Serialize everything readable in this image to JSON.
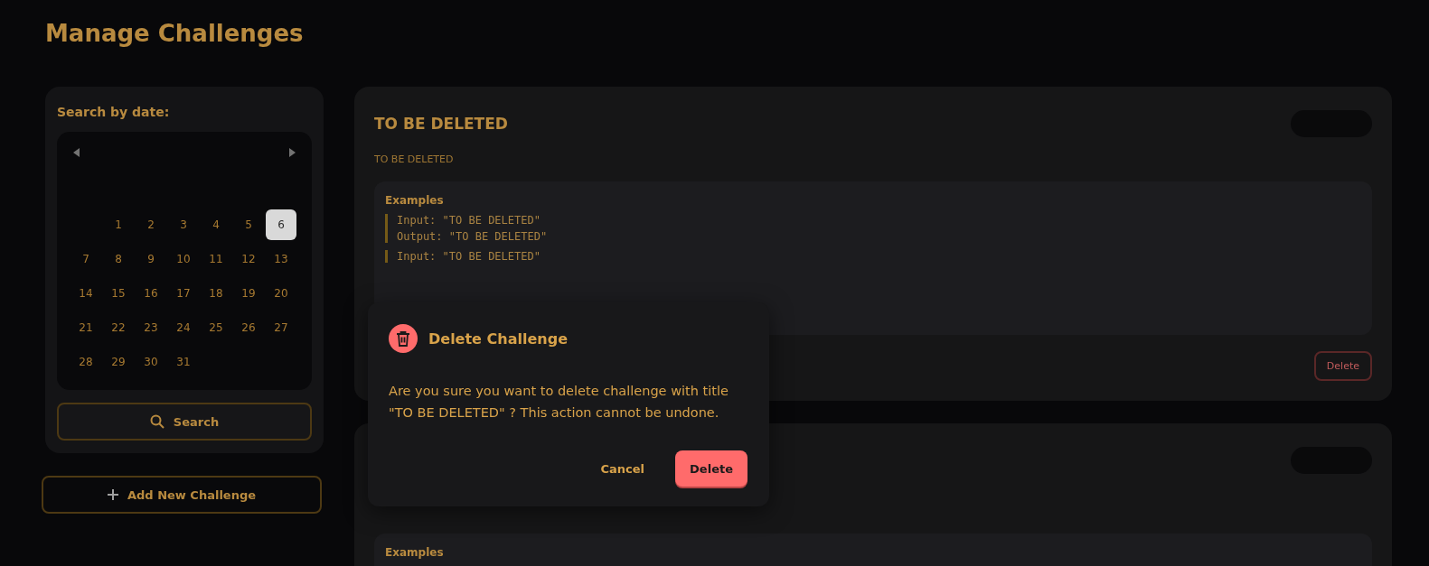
{
  "page": {
    "title": "Manage Challenges"
  },
  "search_panel": {
    "label": "Search by date:",
    "days": [
      {
        "kind": "blank"
      },
      {
        "kind": "day",
        "label": "1",
        "selected": false
      },
      {
        "kind": "day",
        "label": "2",
        "selected": false
      },
      {
        "kind": "day",
        "label": "3",
        "selected": false
      },
      {
        "kind": "day",
        "label": "4",
        "selected": false
      },
      {
        "kind": "day",
        "label": "5",
        "selected": false
      },
      {
        "kind": "day",
        "label": "6",
        "selected": true
      },
      {
        "kind": "day",
        "label": "7",
        "selected": false
      },
      {
        "kind": "day",
        "label": "8",
        "selected": false
      },
      {
        "kind": "day",
        "label": "9",
        "selected": false
      },
      {
        "kind": "day",
        "label": "10",
        "selected": false
      },
      {
        "kind": "day",
        "label": "11",
        "selected": false
      },
      {
        "kind": "day",
        "label": "12",
        "selected": false
      },
      {
        "kind": "day",
        "label": "13",
        "selected": false
      },
      {
        "kind": "day",
        "label": "14",
        "selected": false
      },
      {
        "kind": "day",
        "label": "15",
        "selected": false
      },
      {
        "kind": "day",
        "label": "16",
        "selected": false
      },
      {
        "kind": "day",
        "label": "17",
        "selected": false
      },
      {
        "kind": "day",
        "label": "18",
        "selected": false
      },
      {
        "kind": "day",
        "label": "19",
        "selected": false
      },
      {
        "kind": "day",
        "label": "20",
        "selected": false
      },
      {
        "kind": "day",
        "label": "21",
        "selected": false
      },
      {
        "kind": "day",
        "label": "22",
        "selected": false
      },
      {
        "kind": "day",
        "label": "23",
        "selected": false
      },
      {
        "kind": "day",
        "label": "24",
        "selected": false
      },
      {
        "kind": "day",
        "label": "25",
        "selected": false
      },
      {
        "kind": "day",
        "label": "26",
        "selected": false
      },
      {
        "kind": "day",
        "label": "27",
        "selected": false
      },
      {
        "kind": "day",
        "label": "28",
        "selected": false
      },
      {
        "kind": "day",
        "label": "29",
        "selected": false
      },
      {
        "kind": "day",
        "label": "30",
        "selected": false
      },
      {
        "kind": "day",
        "label": "31",
        "selected": false
      }
    ],
    "search_button": "Search"
  },
  "add_button": "Add New Challenge",
  "challenges": [
    {
      "title": "TO BE DELETED",
      "description": "TO BE DELETED",
      "examples_label": "Examples",
      "examples": [
        [
          "Input: \"TO BE DELETED\"",
          "Output: \"TO BE DELETED\""
        ],
        [
          "Input: \"TO BE DELETED\""
        ]
      ],
      "delete_label": "Delete"
    },
    {
      "examples_label": "Examples"
    }
  ],
  "dialog": {
    "title": "Delete Challenge",
    "message": "Are you sure you want to delete challenge with title \"TO BE DELETED\" ? This action cannot be undone.",
    "buttons": [
      {
        "label": "Cancel",
        "kind": "text"
      },
      {
        "label": "Delete",
        "kind": "danger"
      }
    ]
  }
}
